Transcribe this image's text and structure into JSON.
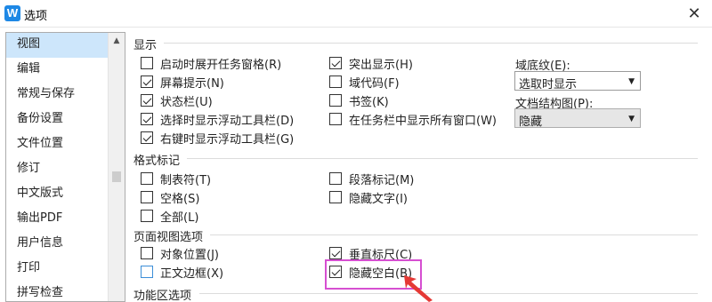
{
  "window": {
    "title": "选项",
    "app_icon_letter": "W"
  },
  "sidebar": {
    "items": [
      "视图",
      "编辑",
      "常规与保存",
      "备份设置",
      "文件位置",
      "修订",
      "中文版式",
      "输出PDF",
      "用户信息",
      "打印",
      "拼写检查"
    ],
    "selected_index": 0
  },
  "sections": {
    "display": "显示",
    "format_marks": "格式标记",
    "page_view": "页面视图选项",
    "ribbon": "功能区选项"
  },
  "display_options": {
    "left": [
      {
        "label": "启动时展开任务窗格(R)",
        "checked": false
      },
      {
        "label": "屏幕提示(N)",
        "checked": true
      },
      {
        "label": "状态栏(U)",
        "checked": true
      },
      {
        "label": "选择时显示浮动工具栏(D)",
        "checked": true
      },
      {
        "label": "右键时显示浮动工具栏(G)",
        "checked": true
      }
    ],
    "middle": [
      {
        "label": "突出显示(H)",
        "checked": true
      },
      {
        "label": "域代码(F)",
        "checked": false
      },
      {
        "label": "书签(K)",
        "checked": false
      },
      {
        "label": "在任务栏中显示所有窗口(W)",
        "checked": false
      }
    ]
  },
  "field_shading": {
    "label": "域底纹(E):",
    "value": "选取时显示"
  },
  "doc_structure": {
    "label": "文档结构图(P):",
    "value": "隐藏"
  },
  "format_mark_options": {
    "left": [
      {
        "label": "制表符(T)",
        "checked": false
      },
      {
        "label": "空格(S)",
        "checked": false
      },
      {
        "label": "全部(L)",
        "checked": false
      }
    ],
    "middle": [
      {
        "label": "段落标记(M)",
        "checked": false
      },
      {
        "label": "隐藏文字(I)",
        "checked": false
      }
    ]
  },
  "page_view_options": {
    "left": [
      {
        "label": "对象位置(J)",
        "checked": false
      },
      {
        "label": "正文边框(X)",
        "checked": false
      }
    ],
    "middle": [
      {
        "label": "垂直标尺(C)",
        "checked": true
      },
      {
        "label": "隐藏空白(B)",
        "checked": true
      }
    ]
  },
  "colors": {
    "highlight_box": "#d64fd1",
    "arrow": "#e53935",
    "selected_item": "#cde6fb"
  }
}
